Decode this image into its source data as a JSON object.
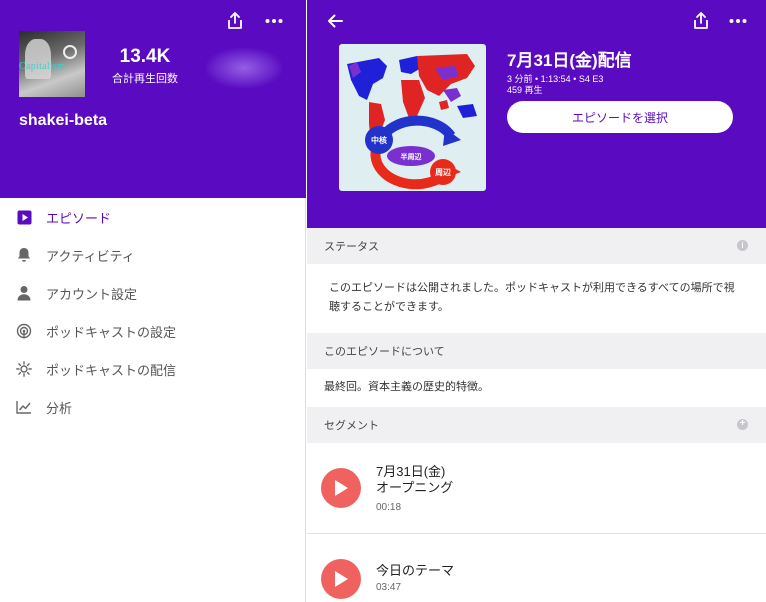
{
  "left": {
    "header": {
      "share_icon": "share-icon",
      "more_icon": "more-icon",
      "cover_text": "Capitalism",
      "total_plays_value": "13.4K",
      "total_plays_label": "合計再生回数",
      "show_name": "shakei-beta"
    },
    "nav": [
      {
        "label": "エピソード",
        "icon": "play-square-icon",
        "active": true
      },
      {
        "label": "アクティビティ",
        "icon": "bell-icon",
        "active": false
      },
      {
        "label": "アカウント設定",
        "icon": "person-icon",
        "active": false
      },
      {
        "label": "ポッドキャストの設定",
        "icon": "podcast-icon",
        "active": false
      },
      {
        "label": "ポッドキャストの配信",
        "icon": "broadcast-icon",
        "active": false
      },
      {
        "label": "分析",
        "icon": "chart-icon",
        "active": false
      }
    ],
    "accent_color": "#5a0ac0"
  },
  "right": {
    "header": {
      "back_icon": "back-arrow-icon",
      "share_icon": "share-icon",
      "more_icon": "more-icon",
      "cover_labels": {
        "core": "中核",
        "semi": "半周辺",
        "periphery": "周辺"
      },
      "episode_title": "7月31日(金)配信",
      "episode_meta": "3 分前 • 1:13:54 • S4 E3",
      "episode_plays": "459 再生",
      "select_button": "エピソードを選択"
    },
    "status": {
      "heading": "ステータス",
      "text": "このエピソードは公開されました。ポッドキャストが利用できるすべての場所で視聴することができます。"
    },
    "about": {
      "heading": "このエピソードについて",
      "text": "最終回。資本主義の歴史的特徴。"
    },
    "segments": {
      "heading": "セグメント",
      "items": [
        {
          "title_line1": "7月31日(金)",
          "title_line2": "オープニング",
          "duration": "00:18"
        },
        {
          "title_line1": "今日のテーマ",
          "title_line2": "",
          "duration": "03:47"
        }
      ]
    }
  },
  "colors": {
    "brand_purple": "#5a0ac0",
    "play_red": "#f0625f",
    "section_bg": "#f0f0f2"
  }
}
